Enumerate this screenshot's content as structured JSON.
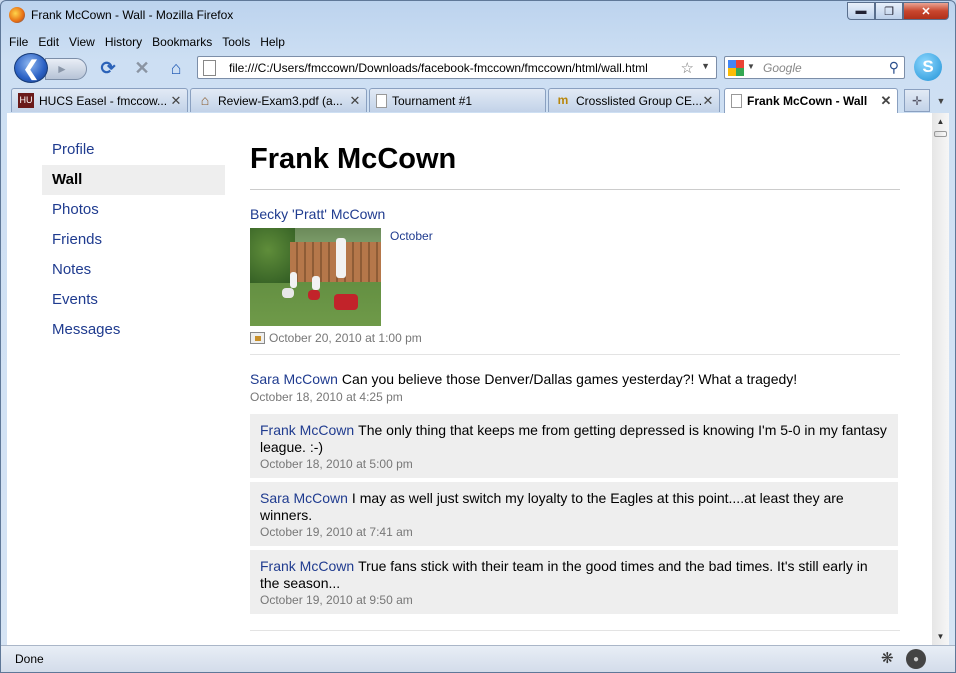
{
  "window": {
    "title": "Frank McCown - Wall - Mozilla Firefox",
    "buttons": {
      "minimize": "▬",
      "maximize": "❐",
      "close": "✕"
    }
  },
  "menu": [
    "File",
    "Edit",
    "View",
    "History",
    "Bookmarks",
    "Tools",
    "Help"
  ],
  "navbar": {
    "url": "file:///C:/Users/fmccown/Downloads/facebook-fmccown/fmccown/html/wall.html",
    "search_placeholder": "Google",
    "icons": [
      "back-icon",
      "forward-icon",
      "reload-icon",
      "stop-icon",
      "home-icon",
      "bookmark-star-icon",
      "search-icon",
      "skype-icon"
    ]
  },
  "tabs": [
    {
      "label": "HUCS Easel - fmccow...",
      "icon": "easel-icon",
      "active": false
    },
    {
      "label": "Review-Exam3.pdf (a...",
      "icon": "house-icon",
      "active": false
    },
    {
      "label": "Tournament #1",
      "icon": "page-icon",
      "active": false
    },
    {
      "label": "Crosslisted Group CE...",
      "icon": "m-icon",
      "active": false
    },
    {
      "label": "Frank McCown - Wall",
      "icon": "page-icon",
      "active": true
    }
  ],
  "sidebar": {
    "items": [
      {
        "label": "Profile",
        "active": false
      },
      {
        "label": "Wall",
        "active": true
      },
      {
        "label": "Photos",
        "active": false
      },
      {
        "label": "Friends",
        "active": false
      },
      {
        "label": "Notes",
        "active": false
      },
      {
        "label": "Events",
        "active": false
      },
      {
        "label": "Messages",
        "active": false
      }
    ]
  },
  "page": {
    "title": "Frank McCown"
  },
  "posts": [
    {
      "author": "Becky 'Pratt' McCown",
      "photo_caption": "October",
      "time": "October 20, 2010 at 1:00 pm"
    },
    {
      "author": "Sara McCown",
      "message": "Can you believe those Denver/Dallas games yesterday?! What a tragedy!",
      "time": "October 18, 2010 at 4:25 pm",
      "comments": [
        {
          "author": "Frank McCown",
          "message": "The only thing that keeps me from getting depressed is knowing I'm 5-0 in my fantasy league. :-)",
          "time": "October 18, 2010 at 5:00 pm"
        },
        {
          "author": "Sara McCown",
          "message": "I may as well just switch my loyalty to the Eagles at this point....at least they are winners.",
          "time": "October 19, 2010 at 7:41 am"
        },
        {
          "author": "Frank McCown",
          "message": "True fans stick with their team in the good times and the bad times. It's still early in the season...",
          "time": "October 19, 2010 at 9:50 am"
        }
      ]
    }
  ],
  "statusbar": {
    "text": "Done"
  },
  "colors": {
    "link": "#1f3b8f",
    "meta": "#777777",
    "comment_bg": "#eeeeee"
  }
}
